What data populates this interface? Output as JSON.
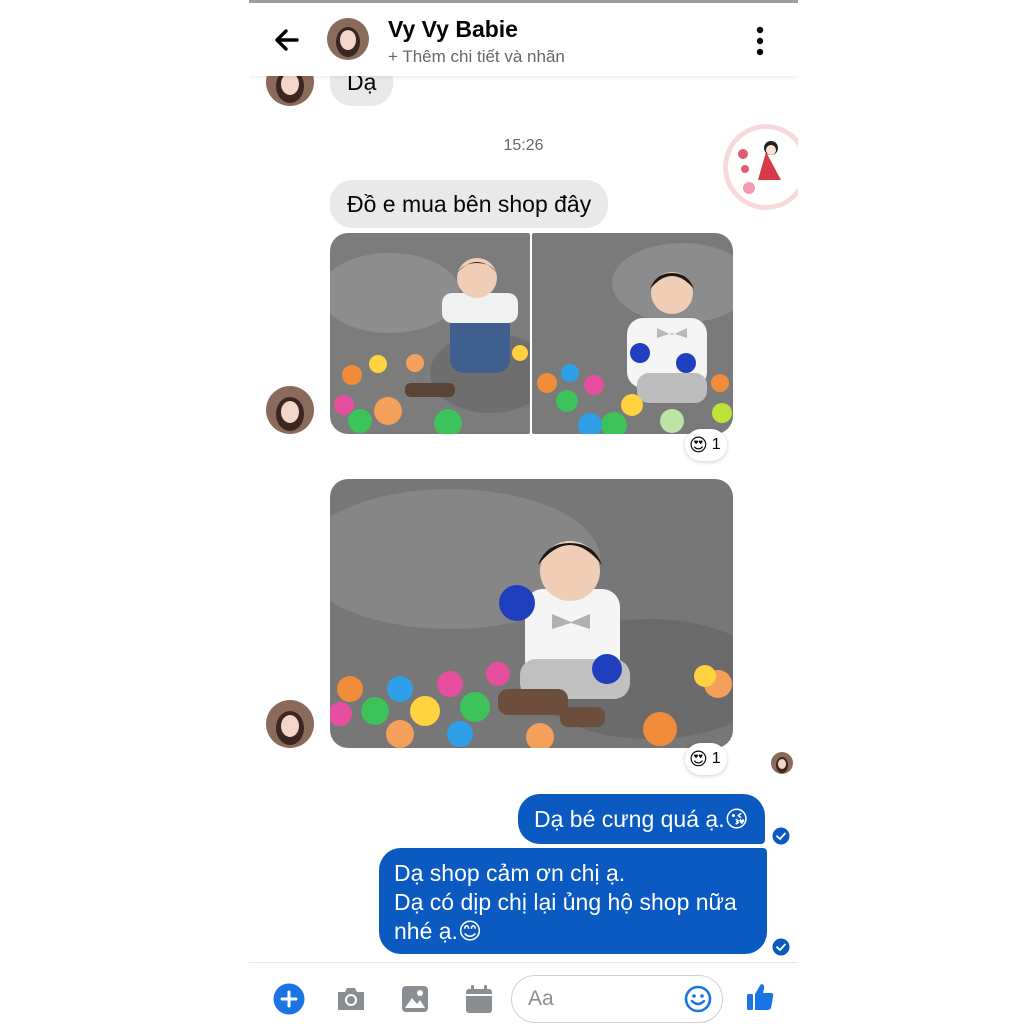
{
  "header": {
    "contact_name": "Vy Vy Babie",
    "subtitle": "+ Thêm chi tiết và nhãn",
    "back_icon": "arrow-left-icon",
    "menu_icon": "kebab-menu-icon"
  },
  "messages": {
    "prev_incoming": "Dạ",
    "timestamp": "15:26",
    "incoming_text": "Đồ e mua bên shop đây",
    "reaction_1_count": "1",
    "reaction_2_count": "1",
    "reaction_emoji": "😍",
    "outgoing_1": "Dạ bé cưng quá ạ.😘",
    "outgoing_2_line1": "Dạ shop cảm ơn chị ạ.",
    "outgoing_2_line2": "Dạ có dịp chị lại ủng hộ shop nữa",
    "outgoing_2_line3": "nhé ạ.😊"
  },
  "composer": {
    "placeholder": "Aa",
    "icons": [
      "plus-icon",
      "camera-icon",
      "gallery-icon",
      "calendar-icon",
      "emoji-icon",
      "like-icon"
    ]
  },
  "colors": {
    "accent": "#0a5ac2",
    "bubble_in": "#e9e9eb",
    "plus_blue": "#1b74e4",
    "like_blue": "#1b74e4"
  }
}
